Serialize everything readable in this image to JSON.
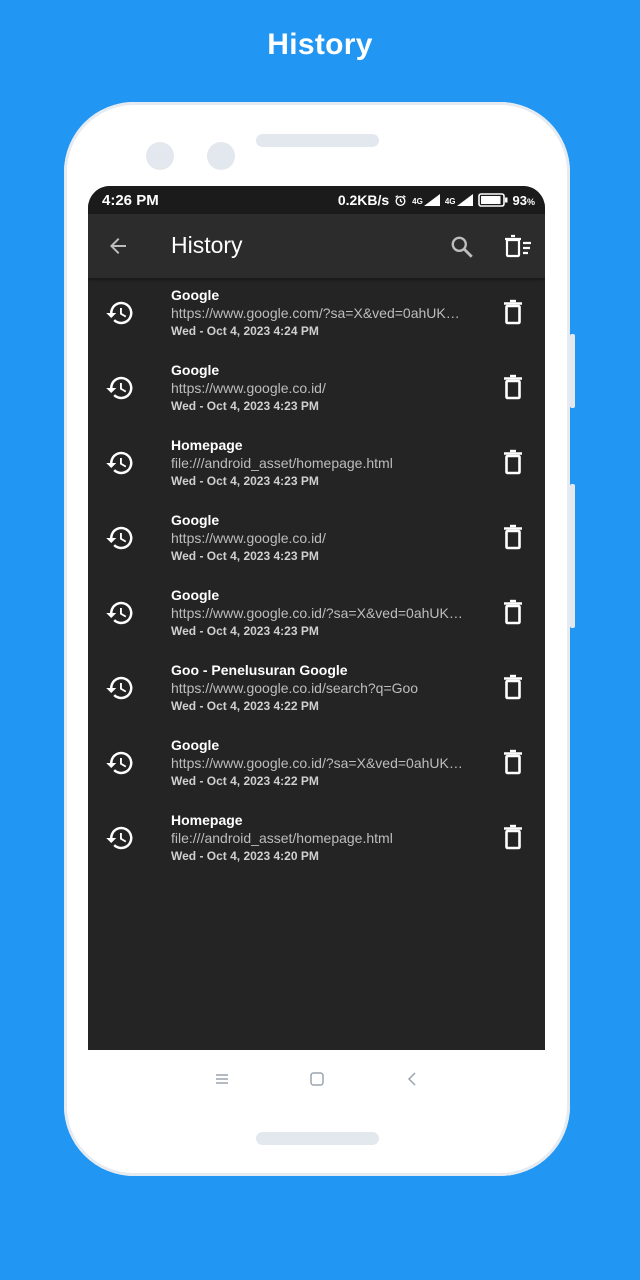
{
  "promo": {
    "title": "History"
  },
  "status_bar": {
    "time": "4:26 PM",
    "net_speed": "0.2KB/s",
    "sim1": "4G",
    "sim2": "4G",
    "battery": "93",
    "battery_unit": "%",
    "battery_level": 0.93,
    "icons": [
      "alarm-icon",
      "signal-icon",
      "signal-icon",
      "battery-icon"
    ]
  },
  "toolbar": {
    "title": "History",
    "icons": [
      "back-arrow-icon",
      "search-icon",
      "clear-all-icon"
    ]
  },
  "history": [
    {
      "title": "Google",
      "url": "https://www.google.com/?sa=X&ved=0ahUKE...",
      "time": "Wed - Oct 4, 2023 4:24 PM"
    },
    {
      "title": "Google",
      "url": "https://www.google.co.id/",
      "time": "Wed - Oct 4, 2023 4:23 PM"
    },
    {
      "title": "Homepage",
      "url": "file:///android_asset/homepage.html",
      "time": "Wed - Oct 4, 2023 4:23 PM"
    },
    {
      "title": "Google",
      "url": "https://www.google.co.id/",
      "time": "Wed - Oct 4, 2023 4:23 PM"
    },
    {
      "title": "Google",
      "url": "https://www.google.co.id/?sa=X&ved=0ahUKE...",
      "time": "Wed - Oct 4, 2023 4:23 PM"
    },
    {
      "title": "Goo - Penelusuran Google",
      "url": "https://www.google.co.id/search?q=Goo",
      "time": "Wed - Oct 4, 2023 4:22 PM"
    },
    {
      "title": "Google",
      "url": "https://www.google.co.id/?sa=X&ved=0ahUKE...",
      "time": "Wed - Oct 4, 2023 4:22 PM"
    },
    {
      "title": "Homepage",
      "url": "file:///android_asset/homepage.html",
      "time": "Wed - Oct 4, 2023 4:20 PM"
    }
  ],
  "colors": {
    "promo_background": "#2196f3",
    "screen_background": "#242424",
    "toolbar_background": "#2c2c2c",
    "text_primary": "#ffffff",
    "text_secondary": "#bdbdbd"
  },
  "nav_icons": [
    "menu-icon",
    "home-icon",
    "back-icon"
  ]
}
